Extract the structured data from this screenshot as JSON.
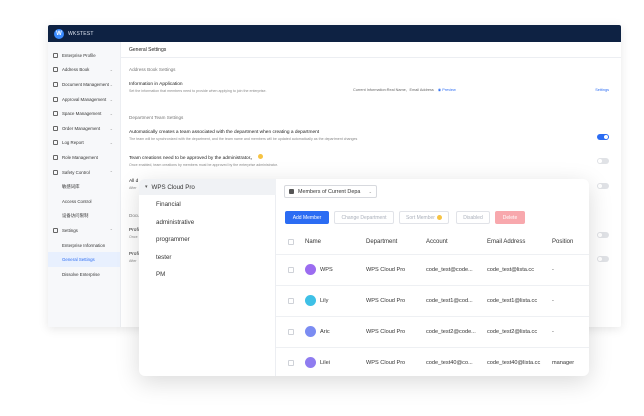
{
  "app": {
    "logo_letter": "W",
    "name": "WKSTEST"
  },
  "sidebar": {
    "items": [
      {
        "label": "Enterprise Profile",
        "chev": ""
      },
      {
        "label": "Address Book",
        "chev": "⌄"
      },
      {
        "label": "Document Management",
        "chev": "⌄"
      },
      {
        "label": "Approval Management",
        "chev": "⌄"
      },
      {
        "label": "Space Management",
        "chev": "⌄"
      },
      {
        "label": "Order Management",
        "chev": "⌄"
      },
      {
        "label": "Log Report",
        "chev": "⌄"
      },
      {
        "label": "Role Management",
        "chev": ""
      },
      {
        "label": "Safety Control",
        "chev": "⌃"
      },
      {
        "label": "敏感词库",
        "chev": ""
      },
      {
        "label": "Access Control",
        "chev": ""
      },
      {
        "label": "设备访问限制",
        "chev": ""
      },
      {
        "label": "Settings",
        "chev": "⌃"
      },
      {
        "label": "Enterprise Information",
        "chev": ""
      },
      {
        "label": "General Settings",
        "chev": ""
      },
      {
        "label": "Dissolve Enterprise",
        "chev": ""
      }
    ]
  },
  "main": {
    "title": "General Settings",
    "address_book_title": "Address Book Settings",
    "info_app_title": "Information in Application",
    "info_app_desc": "Set the information that members need to provide when applying to join the enterprise.",
    "info_fields": "Current Information:Real Name、Email Address",
    "preview_label": "Preview",
    "settings_link": "Settings",
    "dept_team_title": "Department Team Settings",
    "auto_team_title": "Automatically creates a team associated with the department when creating a department",
    "auto_team_desc": "The team will be synchronized with the department, and the team name and members will be updated automatically as the department changes",
    "team_approval_title": "Team creations need to be approved by the administrator。",
    "team_approval_desc": "Once enabled, team creations by members must be approved by the enterprise administrator.",
    "partial_1": "All d",
    "partial_1b": "After",
    "partial_2": "Docu",
    "partial_3": "Profi",
    "partial_3b": "Once",
    "partial_4": "Profi",
    "partial_4b": "After"
  },
  "card": {
    "root_dept": "WPS Cloud Pro",
    "departments": [
      "Financial",
      "administrative",
      "programmer",
      "tester",
      "PM"
    ],
    "member_select": "Members of Current Depa",
    "buttons": {
      "add": "Add Member",
      "change": "Change Department",
      "sort": "Sort Member",
      "disabled": "Disabled",
      "delete": "Delete"
    },
    "columns": [
      "Name",
      "Department",
      "Account",
      "Email Address",
      "Position"
    ],
    "rows": [
      {
        "name": "WPS",
        "dept": "WPS Cloud Pro",
        "account": "code_test@code...",
        "email": "code_test@lista.cc",
        "position": "-",
        "avatar_color": "#9b6cf0"
      },
      {
        "name": "Lily",
        "dept": "WPS Cloud Pro",
        "account": "code_test1@cod...",
        "email": "code_test1@lista.cc",
        "position": "-",
        "avatar_color": "#3ec0e6"
      },
      {
        "name": "Aric",
        "dept": "WPS Cloud Pro",
        "account": "code_test2@code...",
        "email": "code_test2@lista.cc",
        "position": "-",
        "avatar_color": "#7b8cf2"
      },
      {
        "name": "Lilei",
        "dept": "WPS Cloud Pro",
        "account": "code_test40@co...",
        "email": "code_test40@lista.cc",
        "position": "manager",
        "avatar_color": "#8f7cf0"
      }
    ]
  },
  "colors": {
    "accent": "#2b6cf3",
    "titlebar": "#0e2243",
    "danger": "#f8a8ad"
  }
}
